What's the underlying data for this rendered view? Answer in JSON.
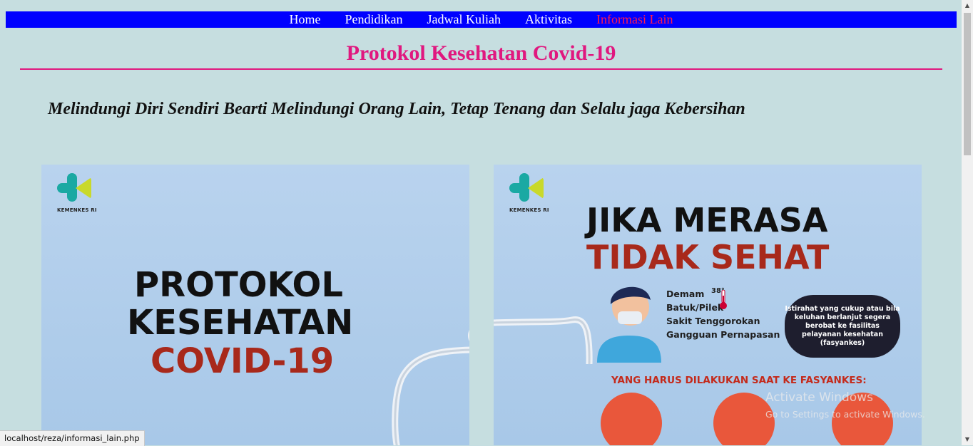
{
  "nav": {
    "items": [
      {
        "label": "Home"
      },
      {
        "label": "Pendidikan"
      },
      {
        "label": "Jadwal Kuliah"
      },
      {
        "label": "Aktivitas"
      },
      {
        "label": "Informasi Lain"
      }
    ],
    "active_index": 4
  },
  "page": {
    "title": "Protokol Kesehatan Covid-19",
    "tagline": "Melindungi Diri Sendiri Bearti Melindungi Orang Lain, Tetap Tenang dan Selalu jaga Kebersihan"
  },
  "poster1": {
    "logo_text": "KEMENKES RI",
    "line1": "PROTOKOL",
    "line2": "KESEHATAN",
    "line3": "COVID-19"
  },
  "poster2": {
    "logo_text": "KEMENKES RI",
    "line1": "JIKA MERASA",
    "line2": "TIDAK SEHAT",
    "temperature": "38°",
    "symptoms": [
      "Demam",
      "Batuk/Pilek",
      "Sakit Tenggorokan",
      "Gangguan Pernapasan"
    ],
    "advice": "Istirahat yang cukup atau bila keluhan berlanjut segera berobat ke fasilitas pelayanan kesehatan (fasyankes)",
    "must_do": "YANG HARUS DILAKUKAN SAAT KE FASYANKES:"
  },
  "watermark": {
    "line1": "Activate Windows",
    "line2": "Go to Settings to activate Windows."
  },
  "statusbar": {
    "url": "localhost/reza/informasi_lain.php"
  },
  "colors": {
    "nav_bg": "#0000ff",
    "accent": "#e0187f",
    "active_link": "#ff1a4e",
    "page_bg": "#c6dee0"
  }
}
